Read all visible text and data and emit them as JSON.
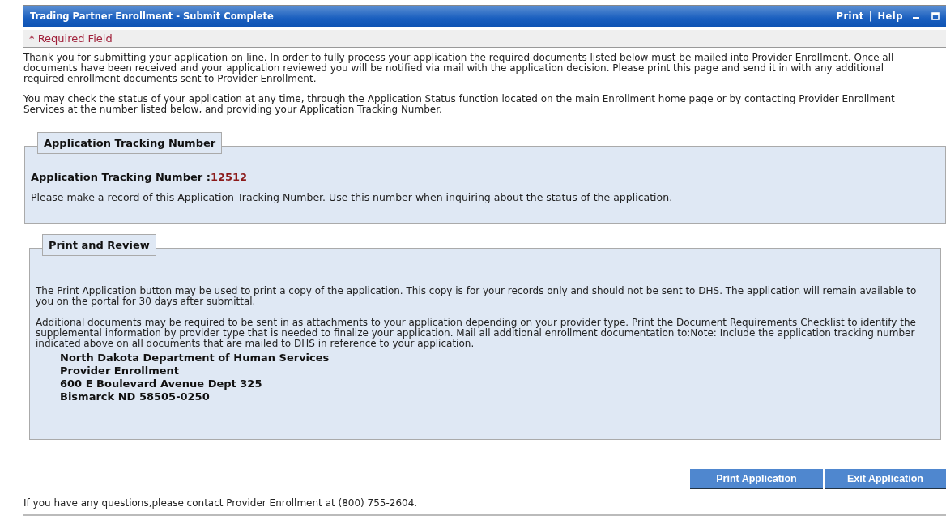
{
  "window": {
    "title": "Trading Partner Enrollment - Submit Complete",
    "links": [
      "Print",
      "Help"
    ],
    "separator": "|"
  },
  "required_note": "* Required Field",
  "intro": [
    "Thank you for submitting your application on-line. In order to fully process your application the required documents listed below must be mailed into Provider Enrollment. Once all documents have been received and your application reviewed you will be notified via mail with the application decision. Please print this page and send it in with any additional required enrollment documents sent to Provider Enrollment.",
    "You may check the status of your application at any time, through the Application Status function located on the main Enrollment home page or by contacting Provider Enrollment Services at the number listed below, and providing your Application Tracking Number."
  ],
  "tracking": {
    "legend": "Application Tracking Number",
    "label": "Application Tracking Number :",
    "value": "12512",
    "note": "Please make a record of this Application Tracking Number. Use this number when inquiring about the status of the application."
  },
  "review": {
    "legend": "Print and Review",
    "paragraphs": [
      "The Print Application button may be used to print a copy of the application.  This copy is for your records only and should not be sent to DHS.  The application will remain available to you on the portal for 30 days after submittal.",
      "Additional documents may be required to be sent in as attachments to your application depending on your provider type.  Print the Document Requirements Checklist to identify the supplemental information by provider type that is needed to finalize your application.  Mail all additional enrollment documentation to:Note:  Include the application tracking number indicated above on all documents that are mailed to DHS in reference to your application."
    ],
    "address": [
      "North Dakota Department of Human Services",
      "Provider Enrollment",
      "600 E Boulevard Avenue Dept 325",
      "Bismarck ND 58505-0250"
    ]
  },
  "buttons": [
    "Print Application",
    "Exit Application"
  ],
  "footer": "If you have any questions,please contact Provider Enrollment at (800) 755-2604."
}
